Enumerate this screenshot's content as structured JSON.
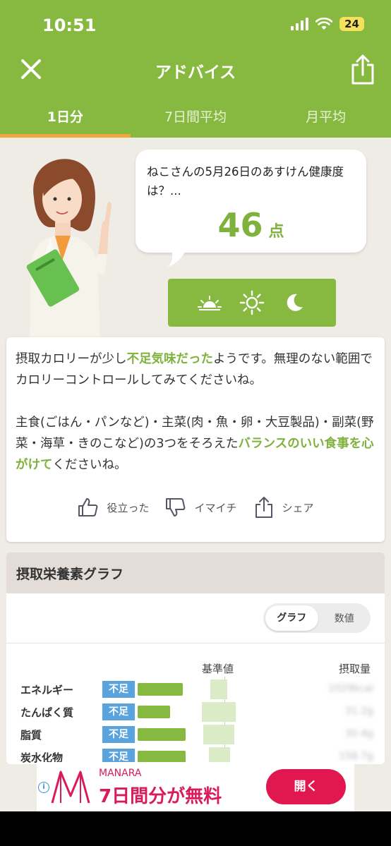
{
  "status": {
    "time": "10:51",
    "battery": "24"
  },
  "header": {
    "title": "アドバイス"
  },
  "tabs": [
    "1日分",
    "7日間平均",
    "月平均"
  ],
  "bubble": {
    "question": "ねこさんの5月26日のあすけん健康度は？...",
    "score": "46",
    "unit": "点"
  },
  "advice": {
    "p1_a": "摂取カロリーが少し",
    "p1_hl": "不足気味だった",
    "p1_b": "ようです。無理のない範囲でカロリーコントロールしてみてくださいね。",
    "p2_a": "主食(ごはん・パンなど)・主菜(肉・魚・卵・大豆製品)・副菜(野菜・海草・きのこなど)の3つをそろえた",
    "p2_hl": "バランスのいい食事を心がけて",
    "p2_b": "くださいね。"
  },
  "feedback": {
    "like": "役立った",
    "dislike": "イマイチ",
    "share": "シェア"
  },
  "graph": {
    "title": "摂取栄養素グラフ",
    "toggle": [
      "グラフ",
      "数値"
    ],
    "col_ref": "基準値",
    "col_amount": "摂取量",
    "rows": [
      {
        "name": "エネルギー",
        "status": "不足",
        "amount": "1029kcal"
      },
      {
        "name": "たんぱく質",
        "status": "不足",
        "amount": "31.2g"
      },
      {
        "name": "脂質",
        "status": "不足",
        "amount": "30.4g"
      },
      {
        "name": "炭水化物",
        "status": "不足",
        "amount": "158.7g"
      }
    ]
  },
  "ad": {
    "brand": "MANARA",
    "text": "7日間分が無料",
    "button": "開く"
  },
  "colors": {
    "primary": "#87b940",
    "accent": "#f3a63b",
    "badge": "#5aa3dd",
    "ad": "#e0184f"
  }
}
